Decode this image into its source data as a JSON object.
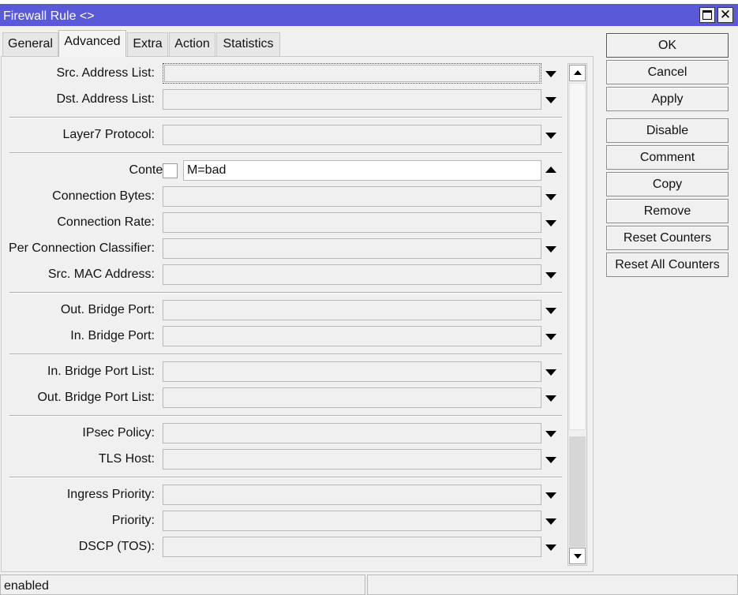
{
  "window": {
    "title": "Firewall Rule <>",
    "maximize_icon": "maximize-icon",
    "close_icon": "close-icon",
    "close_glyph": "✕",
    "title_color": "#5a5ad8"
  },
  "tabs": [
    {
      "label": "General"
    },
    {
      "label": "Advanced",
      "active": true
    },
    {
      "label": "Extra"
    },
    {
      "label": "Action"
    },
    {
      "label": "Statistics"
    }
  ],
  "form": {
    "src_address_list": {
      "label": "Src. Address List:",
      "value": ""
    },
    "dst_address_list": {
      "label": "Dst. Address List:",
      "value": ""
    },
    "layer7_protocol": {
      "label": "Layer7 Protocol:",
      "value": ""
    },
    "content": {
      "label": "Content:",
      "value": "M=bad",
      "negate": false
    },
    "connection_bytes": {
      "label": "Connection Bytes:",
      "value": ""
    },
    "connection_rate": {
      "label": "Connection Rate:",
      "value": ""
    },
    "per_connection_classifier": {
      "label": "Per Connection Classifier:",
      "value": ""
    },
    "src_mac_address": {
      "label": "Src. MAC Address:",
      "value": ""
    },
    "out_bridge_port": {
      "label": "Out. Bridge Port:",
      "value": ""
    },
    "in_bridge_port": {
      "label": "In. Bridge Port:",
      "value": ""
    },
    "in_bridge_port_list": {
      "label": "In. Bridge Port List:",
      "value": ""
    },
    "out_bridge_port_list": {
      "label": "Out. Bridge Port List:",
      "value": ""
    },
    "ipsec_policy": {
      "label": "IPsec Policy:",
      "value": ""
    },
    "tls_host": {
      "label": "TLS Host:",
      "value": ""
    },
    "ingress_priority": {
      "label": "Ingress Priority:",
      "value": ""
    },
    "priority": {
      "label": "Priority:",
      "value": ""
    },
    "dscp_tos": {
      "label": "DSCP (TOS):",
      "value": ""
    }
  },
  "buttons": {
    "ok": "OK",
    "cancel": "Cancel",
    "apply": "Apply",
    "disable": "Disable",
    "comment": "Comment",
    "copy": "Copy",
    "remove": "Remove",
    "reset_counters": "Reset Counters",
    "reset_all_counters": "Reset All Counters"
  },
  "status": {
    "state": "enabled",
    "right": ""
  }
}
